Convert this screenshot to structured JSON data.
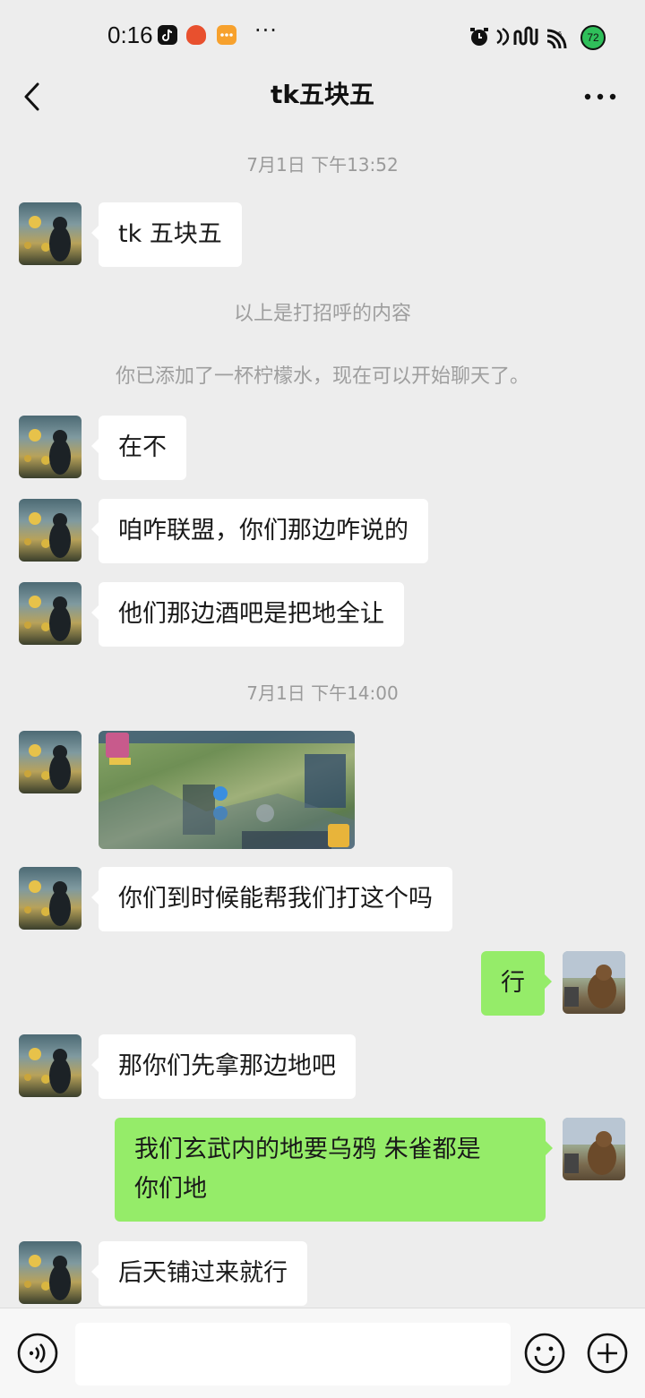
{
  "status_bar": {
    "time": "0:16",
    "icons": [
      "tiktok-icon",
      "app-red-icon",
      "app-orange-icon",
      "more-dots-icon",
      "alarm-icon",
      "nfc-icon",
      "signal-icon",
      "wifi-icon"
    ],
    "more": "···",
    "battery": "72"
  },
  "header": {
    "title": "tk五块五",
    "back_icon": "chevron-left-icon",
    "more_icon": "more-horizontal-icon"
  },
  "messages": [
    {
      "type": "timestamp",
      "text": "7月1日 下午13:52"
    },
    {
      "type": "incoming",
      "text": "tk 五块五"
    },
    {
      "type": "system",
      "text": "以上是打招呼的内容"
    },
    {
      "type": "system",
      "text": "你已添加了一杯柠檬水，现在可以开始聊天了。"
    },
    {
      "type": "incoming",
      "text": "在不"
    },
    {
      "type": "incoming",
      "text": "咱咋联盟，你们那边咋说的"
    },
    {
      "type": "incoming",
      "text": "他们那边酒吧是把地全让"
    },
    {
      "type": "timestamp",
      "text": "7月1日 下午14:00"
    },
    {
      "type": "incoming-image",
      "text": "game-map-screenshot"
    },
    {
      "type": "incoming",
      "text": "你们到时候能帮我们打这个吗"
    },
    {
      "type": "outgoing",
      "text": "行"
    },
    {
      "type": "incoming",
      "text": "那你们先拿那边地吧"
    },
    {
      "type": "outgoing",
      "text": "我们玄武内的地要乌鸦 朱雀都是\n你们地"
    },
    {
      "type": "incoming",
      "text": "后天铺过来就行"
    }
  ],
  "input_bar": {
    "voice_icon": "voice-icon",
    "emoji_icon": "emoji-icon",
    "plus_icon": "plus-circle-icon",
    "placeholder": ""
  },
  "colors": {
    "background": "#ededed",
    "outgoing_bubble": "#95ec69",
    "incoming_bubble": "#ffffff",
    "system_text": "#9e9e9e"
  }
}
